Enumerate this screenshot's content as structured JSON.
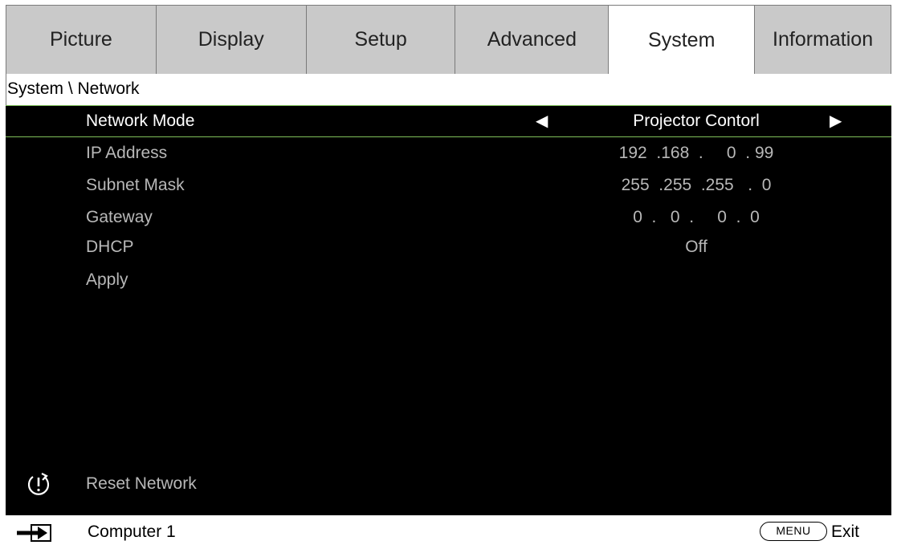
{
  "tabs": [
    "Picture",
    "Display",
    "Setup",
    "Advanced",
    "System",
    "Information"
  ],
  "breadcrumb": "System \\ Network",
  "rows": [
    {
      "label": "Network Mode",
      "value": "Projector Contorl"
    },
    {
      "label": "IP Address",
      "value": "192  .168  .     0  . 99"
    },
    {
      "label": "Subnet Mask",
      "value": "255  .255  .255   .  0"
    },
    {
      "label": "Gateway",
      "value": "0  .   0  .     0  .  0"
    },
    {
      "label": "DHCP",
      "value": "Off"
    },
    {
      "label": "Apply",
      "value": ""
    }
  ],
  "reset": {
    "label": "Reset Network",
    "icon": "reset-power-icon"
  },
  "footer": {
    "source_icon": "input-source-icon",
    "source": "Computer 1",
    "menu_key": "MENU",
    "exit": "Exit"
  },
  "colors": {
    "highlight_border": "#7fbf5a",
    "active_tab": "#ffffff",
    "inactive_tab": "#c9c9c9"
  }
}
